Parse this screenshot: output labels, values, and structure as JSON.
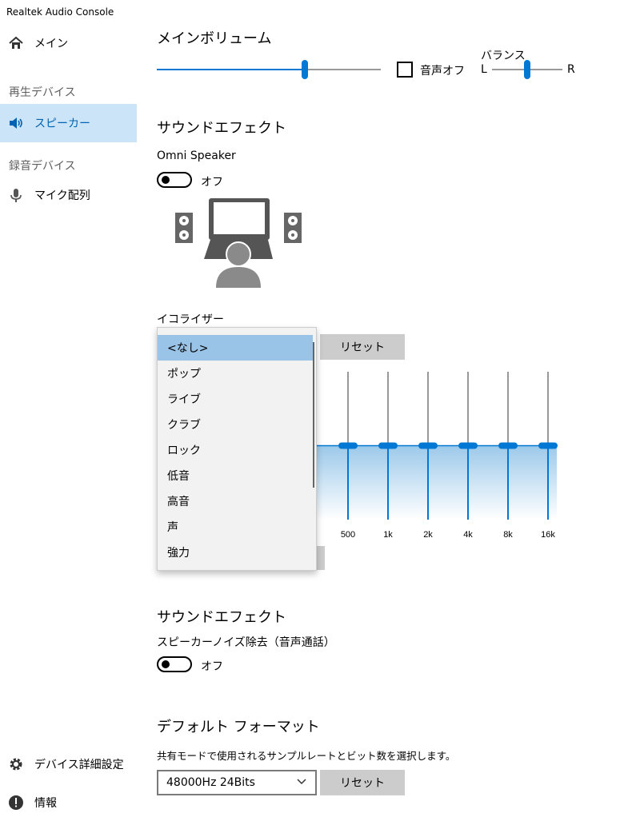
{
  "app": {
    "title": "Realtek Audio Console"
  },
  "sidebar": {
    "main": {
      "label": "メイン",
      "icon": "home-icon"
    },
    "playback_section": "再生デバイス",
    "speaker": {
      "label": "スピーカー",
      "icon": "speaker-icon"
    },
    "recording_section": "録音デバイス",
    "mic_array": {
      "label": "マイク配列",
      "icon": "microphone-icon"
    },
    "advanced": {
      "label": "デバイス詳細設定",
      "icon": "gear-icon"
    },
    "info": {
      "label": "情報",
      "icon": "info-icon"
    }
  },
  "main_volume": {
    "title": "メインボリューム",
    "level": 0.66,
    "mute_label": "音声オフ",
    "mute_checked": false,
    "balance_label": "バランス",
    "balance_left": "L",
    "balance_right": "R",
    "balance_level": 0.5
  },
  "sound_effect_1": {
    "title": "サウンドエフェクト",
    "omni_label": "Omni Speaker",
    "omni_state": "オフ",
    "omni_on": false
  },
  "equalizer": {
    "label": "イコライザー",
    "reset_label": "リセット",
    "band_labels": [
      "500",
      "1k",
      "2k",
      "4k",
      "8k",
      "16k"
    ],
    "band_level": 0.0,
    "dropdown": {
      "items": [
        "<なし>",
        "ポップ",
        "ライブ",
        "クラブ",
        "ロック",
        "低音",
        "高音",
        "声",
        "強力"
      ],
      "selected_index": 0
    }
  },
  "sound_effect_2": {
    "title": "サウンドエフェクト",
    "noise_label": "スピーカーノイズ除去（音声通話）",
    "noise_state": "オフ",
    "noise_on": false
  },
  "default_format": {
    "title": "デフォルト フォーマット",
    "description": "共有モードで使用されるサンプルレートとビット数を選択します。",
    "value": "48000Hz 24Bits",
    "reset_label": "リセット"
  },
  "colors": {
    "accent": "#0078d4",
    "nav_active_bg": "#cce4f7",
    "nav_active_text": "#0063b1"
  }
}
